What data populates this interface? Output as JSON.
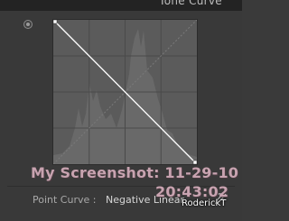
{
  "panel": {
    "title": "Tone Curve"
  },
  "curve": {
    "type_label": "Point Curve :",
    "type_value": "Negative Linear",
    "points": [
      {
        "input": 0,
        "output": 255
      },
      {
        "input": 255,
        "output": 0
      }
    ]
  },
  "watermark": {
    "line1": "My Screenshot: 11-29-10",
    "line2": "20:43:02",
    "author": "RoderickT"
  },
  "colors": {
    "panel_bg": "#393939",
    "curve_bg": "#5b5b5b",
    "histogram": "#6a6a6a",
    "curve_line": "#ffffff",
    "watermark": "#c8a3b0"
  },
  "icons": {
    "target": "targeted-adjustment-icon",
    "edit": "edit-point-curve-icon"
  }
}
